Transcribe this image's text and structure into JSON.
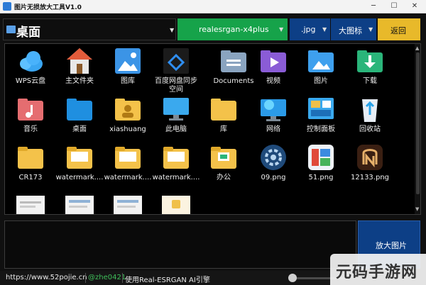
{
  "window": {
    "title": "图片无损放大工具V1.0",
    "minimize": "─",
    "maximize": "☐",
    "close": "✕"
  },
  "toolbar": {
    "path": "桌面",
    "model": "realesrgan-x4plus",
    "format": ".jpg",
    "view_mode": "大图标",
    "back_label": "返回"
  },
  "files": [
    {
      "label": "WPS云盘",
      "icon": "wps-cloud-icon"
    },
    {
      "label": "主文件夹",
      "icon": "home-icon"
    },
    {
      "label": "图库",
      "icon": "gallery-icon"
    },
    {
      "label": "百度网盘同步空间",
      "label2": "空间",
      "label1": "百度网盘同步",
      "icon": "baidu-netdisk-icon"
    },
    {
      "label": "Documents",
      "icon": "documents-folder-icon"
    },
    {
      "label": "视频",
      "icon": "video-folder-icon"
    },
    {
      "label": "图片",
      "icon": "pictures-folder-icon"
    },
    {
      "label": "下载",
      "icon": "download-folder-icon"
    },
    {
      "label": "音乐",
      "icon": "music-folder-icon"
    },
    {
      "label": "桌面",
      "icon": "desktop-folder-icon"
    },
    {
      "label": "xiashuang",
      "icon": "user-folder-icon"
    },
    {
      "label": "此电脑",
      "icon": "this-pc-icon"
    },
    {
      "label": "库",
      "icon": "library-folder-icon"
    },
    {
      "label": "网络",
      "icon": "network-icon"
    },
    {
      "label": "控制面板",
      "icon": "control-panel-icon"
    },
    {
      "label": "回收站",
      "icon": "recycle-bin-icon"
    },
    {
      "label": "CR173",
      "icon": "folder-icon"
    },
    {
      "label": "watermark....",
      "icon": "folder-icon"
    },
    {
      "label": "watermark....",
      "icon": "folder-icon"
    },
    {
      "label": "watermark....",
      "icon": "folder-icon"
    },
    {
      "label": "办公",
      "icon": "folder-icon"
    },
    {
      "label": "09.png",
      "icon": "png-thumbnail-icon"
    },
    {
      "label": "51.png",
      "icon": "png-thumbnail-icon"
    },
    {
      "label": "12133.png",
      "icon": "png-thumbnail-icon"
    }
  ],
  "enlarge_label": "放大图片",
  "status": {
    "url": "https://www.52pojie.cn",
    "user": "@zhe0421",
    "engine": "使用Real-ESRGAN AI引擎"
  },
  "overlay_watermark": "元码手游网",
  "colors": {
    "model_bg": "#16a34a",
    "select_bg": "#0d3f86",
    "back_bg": "#e8b92a"
  }
}
